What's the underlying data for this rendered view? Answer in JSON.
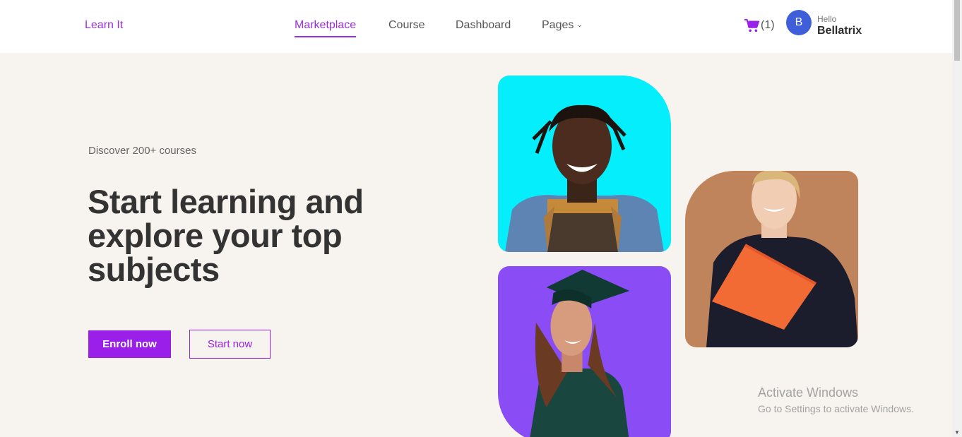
{
  "header": {
    "brand": "Learn It",
    "nav": [
      {
        "label": "Marketplace",
        "active": true
      },
      {
        "label": "Course",
        "active": false
      },
      {
        "label": "Dashboard",
        "active": false
      },
      {
        "label": "Pages",
        "active": false,
        "has_dropdown": true
      }
    ],
    "cart_count": "(1)",
    "avatar_initial": "B",
    "greeting": "Hello",
    "username": "Bellatrix"
  },
  "hero": {
    "eyebrow": "Discover 200+ courses",
    "headline_lines": [
      "Start learning and",
      "explore your top",
      "subjects"
    ],
    "primary_button": "Enroll now",
    "secondary_button": "Start now"
  },
  "images": [
    {
      "icon": "student-smiling-photo",
      "bg": "#05eefc"
    },
    {
      "icon": "graduate-photo",
      "bg": "#8a4cf5"
    },
    {
      "icon": "student-holding-book-photo",
      "bg": "#c0845c"
    }
  ],
  "watermark": {
    "title": "Activate Windows",
    "subtitle": "Go to Settings to activate Windows."
  },
  "colors": {
    "accent": "#9a1fe8",
    "background": "#f7f4ef",
    "avatar": "#3e5fd9"
  }
}
